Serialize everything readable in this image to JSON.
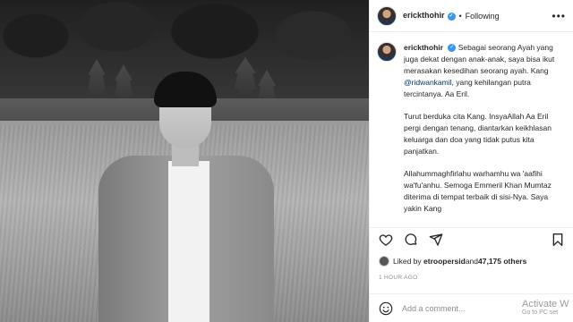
{
  "header": {
    "username": "erickthohir",
    "separator": "•",
    "follow_status": "Following",
    "more": "•••"
  },
  "caption": {
    "username": "erickthohir",
    "p1_before": "Sebagai seorang Ayah yang juga dekat dengan anak-anak, saya bisa ikut merasakan kesedihan seorang ayah. Kang ",
    "mention": "@ridwankamil",
    "p1_after": ", yang kehilangan putra tercintanya. Aa Eril.",
    "p2": "Turut berduka cita Kang. InsyaAllah Aa Eril pergi dengan tenang, diantarkan keikhlasan keluarga dan doa yang tidak putus kita panjatkan.",
    "p3": "Allahummaghfirlahu warhamhu wa 'aafihi wa'fu'anhu. Semoga Emmeril Khan Mumtaz diterima di tempat terbaik di sisi-Nya. Saya yakin Kang"
  },
  "likes": {
    "prefix": "Liked by ",
    "user": "etroopersid",
    "and": " and ",
    "count": "47,175 others"
  },
  "timestamp": "1 HOUR AGO",
  "comment": {
    "placeholder": "Add a comment..."
  },
  "watermark": {
    "line1": "Activate W",
    "line2": "Go to PC set"
  },
  "colors": {
    "verified": "#3897f0",
    "mention": "#00376b"
  },
  "icons": [
    "heart-icon",
    "comment-icon",
    "share-icon",
    "bookmark-icon",
    "emoji-icon",
    "verified-badge-icon",
    "more-options-icon"
  ]
}
